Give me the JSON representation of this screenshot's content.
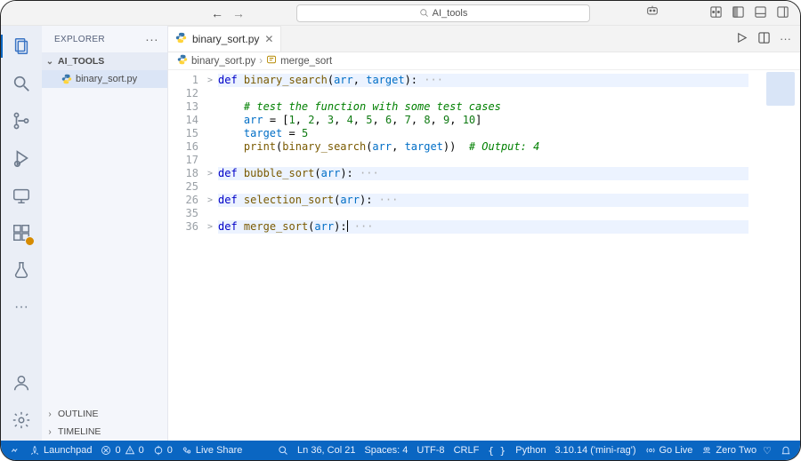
{
  "title_bar": {
    "search_text": "AI_tools"
  },
  "sidebar": {
    "title": "EXPLORER",
    "folder": "AI_TOOLS",
    "files": [
      {
        "name": "binary_sort.py"
      }
    ],
    "panels": [
      "OUTLINE",
      "TIMELINE"
    ]
  },
  "tab": {
    "name": "binary_sort.py"
  },
  "breadcrumb": {
    "file": "binary_sort.py",
    "symbol": "merge_sort"
  },
  "code": {
    "lines": [
      {
        "n": 1,
        "fold": ">",
        "hl": true,
        "tokens": [
          [
            "kw",
            "def"
          ],
          [
            "op",
            " "
          ],
          [
            "fn",
            "binary_search"
          ],
          [
            "op",
            "("
          ],
          [
            "var",
            "arr"
          ],
          [
            "op",
            ", "
          ],
          [
            "var",
            "target"
          ],
          [
            "op",
            "):"
          ],
          [
            "ellips",
            " ···"
          ]
        ]
      },
      {
        "n": 12,
        "fold": "",
        "hl": false,
        "tokens": []
      },
      {
        "n": 13,
        "fold": "",
        "hl": false,
        "tokens": [
          [
            "op",
            "    "
          ],
          [
            "com",
            "# test the function with some test cases"
          ]
        ]
      },
      {
        "n": 14,
        "fold": "",
        "hl": false,
        "tokens": [
          [
            "op",
            "    "
          ],
          [
            "var",
            "arr"
          ],
          [
            "op",
            " = ["
          ],
          [
            "num",
            "1"
          ],
          [
            "op",
            ", "
          ],
          [
            "num",
            "2"
          ],
          [
            "op",
            ", "
          ],
          [
            "num",
            "3"
          ],
          [
            "op",
            ", "
          ],
          [
            "num",
            "4"
          ],
          [
            "op",
            ", "
          ],
          [
            "num",
            "5"
          ],
          [
            "op",
            ", "
          ],
          [
            "num",
            "6"
          ],
          [
            "op",
            ", "
          ],
          [
            "num",
            "7"
          ],
          [
            "op",
            ", "
          ],
          [
            "num",
            "8"
          ],
          [
            "op",
            ", "
          ],
          [
            "num",
            "9"
          ],
          [
            "op",
            ", "
          ],
          [
            "num",
            "10"
          ],
          [
            "op",
            "]"
          ]
        ]
      },
      {
        "n": 15,
        "fold": "",
        "hl": false,
        "tokens": [
          [
            "op",
            "    "
          ],
          [
            "var",
            "target"
          ],
          [
            "op",
            " = "
          ],
          [
            "num",
            "5"
          ]
        ]
      },
      {
        "n": 16,
        "fold": "",
        "hl": false,
        "tokens": [
          [
            "op",
            "    "
          ],
          [
            "fn",
            "print"
          ],
          [
            "op",
            "("
          ],
          [
            "fn",
            "binary_search"
          ],
          [
            "op",
            "("
          ],
          [
            "var",
            "arr"
          ],
          [
            "op",
            ", "
          ],
          [
            "var",
            "target"
          ],
          [
            "op",
            "))  "
          ],
          [
            "com",
            "# Output: 4"
          ]
        ]
      },
      {
        "n": 17,
        "fold": "",
        "hl": false,
        "tokens": []
      },
      {
        "n": 18,
        "fold": ">",
        "hl": true,
        "tokens": [
          [
            "kw",
            "def"
          ],
          [
            "op",
            " "
          ],
          [
            "fn",
            "bubble_sort"
          ],
          [
            "op",
            "("
          ],
          [
            "var",
            "arr"
          ],
          [
            "op",
            "):"
          ],
          [
            "ellips",
            " ···"
          ]
        ]
      },
      {
        "n": 25,
        "fold": "",
        "hl": false,
        "tokens": []
      },
      {
        "n": 26,
        "fold": ">",
        "hl": true,
        "tokens": [
          [
            "kw",
            "def"
          ],
          [
            "op",
            " "
          ],
          [
            "fn",
            "selection_sort"
          ],
          [
            "op",
            "("
          ],
          [
            "var",
            "arr"
          ],
          [
            "op",
            "):"
          ],
          [
            "ellips",
            " ···"
          ]
        ]
      },
      {
        "n": 35,
        "fold": "",
        "hl": false,
        "tokens": []
      },
      {
        "n": 36,
        "fold": ">",
        "hl": true,
        "tokens": [
          [
            "kw",
            "def"
          ],
          [
            "op",
            " "
          ],
          [
            "fn",
            "merge_sort"
          ],
          [
            "op",
            "("
          ],
          [
            "var",
            "arr"
          ],
          [
            "op",
            "):"
          ],
          [
            "cursor",
            ""
          ],
          [
            "ellips",
            " ···"
          ]
        ]
      }
    ]
  },
  "status": {
    "remote": "",
    "launchpad": "Launchpad",
    "errors": "0",
    "warnings": "0",
    "ports": "0",
    "live_share": "Live Share",
    "cursor": "Ln 36, Col 21",
    "spaces": "Spaces: 4",
    "encoding": "UTF-8",
    "eol": "CRLF",
    "language": "Python",
    "interpreter": "3.10.14 ('mini-rag')",
    "go_live": "Go Live",
    "zero_two": "Zero Two"
  }
}
